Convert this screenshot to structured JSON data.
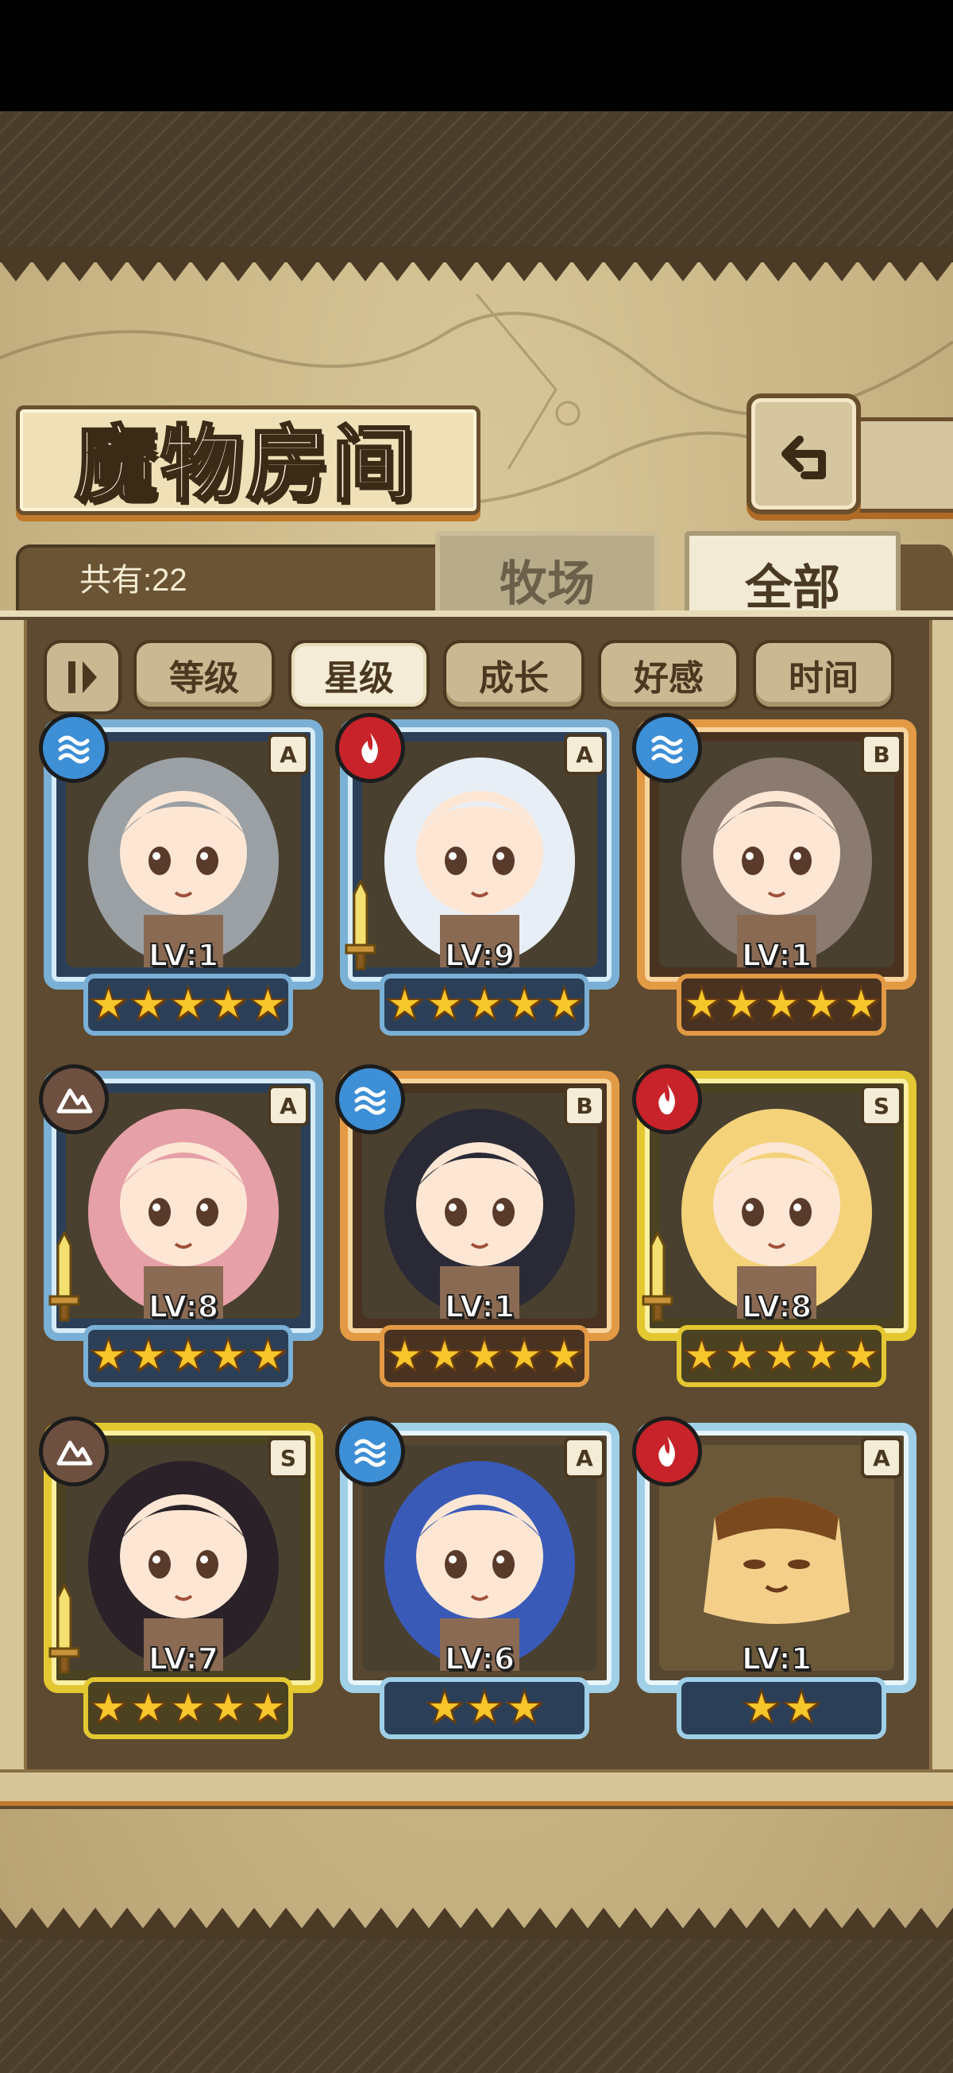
{
  "header": {
    "title": "魔物房间"
  },
  "summary": {
    "count_label": "共有:22"
  },
  "tabs": [
    {
      "label": "牧场"
    },
    {
      "label": "全部"
    }
  ],
  "sort": {
    "toggle_icon": "order-toggle-icon",
    "buttons": [
      {
        "label": "等级"
      },
      {
        "label": "星级"
      },
      {
        "label": "成长"
      },
      {
        "label": "好感"
      },
      {
        "label": "时间"
      }
    ],
    "active": "星级"
  },
  "monsters": [
    {
      "rank": "A",
      "element": "water",
      "level": "LV:1",
      "stars": "★★★★★",
      "frame": "blue",
      "weapon": false
    },
    {
      "rank": "A",
      "element": "fire",
      "level": "LV:9",
      "stars": "★★★★★",
      "frame": "blue",
      "weapon": true
    },
    {
      "rank": "B",
      "element": "water",
      "level": "LV:1",
      "stars": "★★★★★",
      "frame": "orange",
      "weapon": false
    },
    {
      "rank": "A",
      "element": "earth",
      "level": "LV:8",
      "stars": "★★★★★",
      "frame": "blue",
      "weapon": true
    },
    {
      "rank": "B",
      "element": "water",
      "level": "LV:1",
      "stars": "★★★★★",
      "frame": "orange",
      "weapon": false
    },
    {
      "rank": "S",
      "element": "fire",
      "level": "LV:8",
      "stars": "★★★★★",
      "frame": "gold",
      "weapon": true
    },
    {
      "rank": "S",
      "element": "earth",
      "level": "LV:7",
      "stars": "★★★★★",
      "frame": "gold",
      "weapon": true
    },
    {
      "rank": "A",
      "element": "water",
      "level": "LV:6",
      "stars": "★★★",
      "frame": "plain",
      "weapon": false
    },
    {
      "rank": "A",
      "element": "fire",
      "level": "LV:1",
      "stars": "★★",
      "frame": "plain",
      "weapon": false
    }
  ],
  "colors": {
    "parchment": "#c9b585",
    "panel": "#5e4a30",
    "water": "#3d8fd6",
    "fire": "#c8232a",
    "earth": "#6e5040",
    "star": "#f7c62a"
  }
}
